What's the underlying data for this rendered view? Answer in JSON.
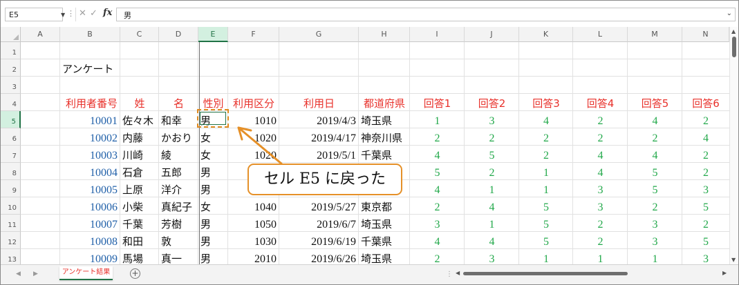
{
  "formula_bar": {
    "name_box": "E5",
    "dots": "⋮",
    "cancel": "✕",
    "enter": "✓",
    "fx": "fx",
    "content": "男"
  },
  "columns": [
    "A",
    "B",
    "C",
    "D",
    "E",
    "F",
    "G",
    "H",
    "I",
    "J",
    "K",
    "L",
    "M",
    "N"
  ],
  "selected_column": "E",
  "rows": [
    "1",
    "2",
    "3",
    "4",
    "5",
    "6",
    "7",
    "8",
    "9",
    "10",
    "11",
    "12",
    "13"
  ],
  "selected_row": "5",
  "title_cell": "アンケート",
  "table": {
    "headers": [
      "利用者番号",
      "姓",
      "名",
      "性別",
      "利用区分",
      "利用日",
      "都道府県",
      "回答1",
      "回答2",
      "回答3",
      "回答4",
      "回答5",
      "回答6"
    ],
    "rows": [
      [
        "10001",
        "佐々木",
        "和幸",
        "男",
        "1010",
        "2019/4/3",
        "埼玉県",
        "1",
        "3",
        "4",
        "2",
        "4",
        "2"
      ],
      [
        "10002",
        "内藤",
        "かおり",
        "女",
        "1020",
        "2019/4/17",
        "神奈川県",
        "2",
        "2",
        "2",
        "2",
        "2",
        "4"
      ],
      [
        "10003",
        "川崎",
        "綾",
        "女",
        "1020",
        "2019/5/1",
        "千葉県",
        "4",
        "5",
        "2",
        "4",
        "4",
        "2"
      ],
      [
        "10004",
        "石倉",
        "五郎",
        "男",
        "",
        "",
        "",
        "5",
        "2",
        "1",
        "4",
        "5",
        "2"
      ],
      [
        "10005",
        "上原",
        "洋介",
        "男",
        "",
        "",
        "",
        "4",
        "1",
        "1",
        "3",
        "5",
        "3"
      ],
      [
        "10006",
        "小柴",
        "真紀子",
        "女",
        "1040",
        "2019/5/27",
        "東京都",
        "2",
        "4",
        "5",
        "3",
        "2",
        "5"
      ],
      [
        "10007",
        "千葉",
        "芳樹",
        "男",
        "1050",
        "2019/6/7",
        "埼玉県",
        "3",
        "1",
        "5",
        "2",
        "3",
        "2"
      ],
      [
        "10008",
        "和田",
        "敦",
        "男",
        "1030",
        "2019/6/19",
        "千葉県",
        "4",
        "4",
        "5",
        "2",
        "3",
        "5"
      ],
      [
        "10009",
        "馬場",
        "真一",
        "男",
        "2010",
        "2019/6/26",
        "埼玉県",
        "2",
        "3",
        "1",
        "1",
        "1",
        "3"
      ]
    ]
  },
  "callout": "セル E5 に戻った",
  "sheet_tab": "アンケート結果",
  "add_sheet": "+",
  "colors": {
    "accent": "#217346",
    "header_red": "#e8302a",
    "id_blue": "#1f5fa8",
    "answer_green": "#22a84a",
    "callout_border": "#e59028"
  }
}
